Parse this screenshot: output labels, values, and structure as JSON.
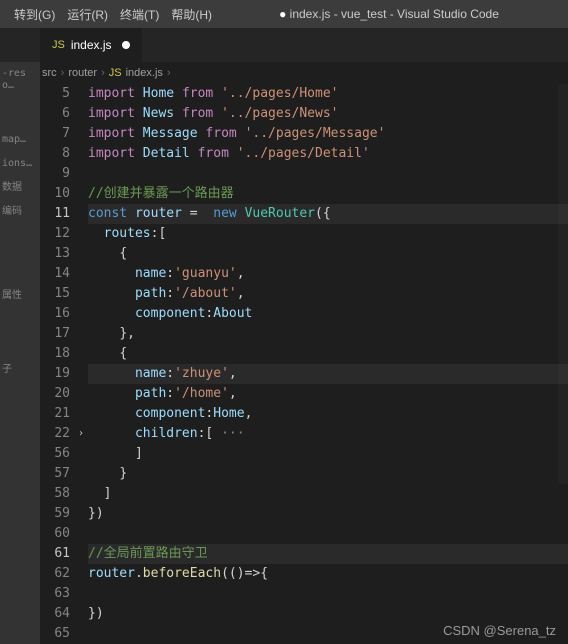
{
  "menu": {
    "goto": "转到(G)",
    "run": "运行(R)",
    "terminal": "终端(T)",
    "help": "帮助(H)"
  },
  "title": {
    "dot": "●",
    "file": "index.js",
    "project": "- vue_test - Visual Studio Code"
  },
  "tab": {
    "icon": "JS",
    "name": "index.js"
  },
  "breadcrumb": {
    "seg1": "src",
    "seg2": "router",
    "seg3": "index.js",
    "sep": "›"
  },
  "activity": [
    "-reso…",
    "map…",
    "ions…",
    "数据",
    "编码",
    "属性",
    "子"
  ],
  "gutter": [
    "5",
    "6",
    "7",
    "8",
    "9",
    "10",
    "11",
    "12",
    "13",
    "14",
    "15",
    "16",
    "17",
    "18",
    "19",
    "20",
    "21",
    "22",
    "56",
    "57",
    "58",
    "59",
    "60",
    "61",
    "62",
    "63",
    "64",
    "65"
  ],
  "code": {
    "l5": {
      "kw1": "import",
      "v": "Home",
      "kw2": "from",
      "s": "'../pages/Home'"
    },
    "l6": {
      "kw1": "import",
      "v": "News",
      "kw2": "from",
      "s": "'../pages/News'"
    },
    "l7": {
      "kw1": "import",
      "v": "Message",
      "kw2": "from",
      "s": "'../pages/Message'"
    },
    "l8": {
      "kw1": "import",
      "v": "Detail",
      "kw2": "from",
      "s": "'../pages/Detail'"
    },
    "l9": "",
    "l10": "//创建并暴露一个路由器",
    "l11": {
      "kw": "const",
      "v": "router",
      "eq": " =  ",
      "nw": "new",
      "cls": "VueRouter",
      "p": "({"
    },
    "l12": {
      "p": "routes",
      "b": ":["
    },
    "l13": "{",
    "l14": {
      "p": "name",
      "c": ":",
      "s": "'guanyu'",
      "t": ","
    },
    "l15": {
      "p": "path",
      "c": ":",
      "s": "'/about'",
      "t": ","
    },
    "l16": {
      "p": "component",
      "c": ":",
      "v": "About"
    },
    "l17": "},",
    "l18": "{",
    "l19": {
      "p": "name",
      "c": ":",
      "s": "'zhuye'",
      "t": ","
    },
    "l20": {
      "p": "path",
      "c": ":",
      "s": "'/home'",
      "t": ","
    },
    "l21": {
      "p": "component",
      "c": ":",
      "v": "Home",
      "t": ","
    },
    "l22": {
      "p": "children",
      "c": ":[",
      "d": " ···"
    },
    "l56": "]",
    "l57": "}",
    "l58": "]",
    "l59": "})",
    "l60": "",
    "l61": "//全局前置路由守卫",
    "l62": {
      "v": "router",
      "d": ".",
      "fn": "beforeEach",
      "p": "(()=>{"
    },
    "l63": "",
    "l64": "})",
    "l65": ""
  },
  "watermark": "CSDN @Serena_tz"
}
